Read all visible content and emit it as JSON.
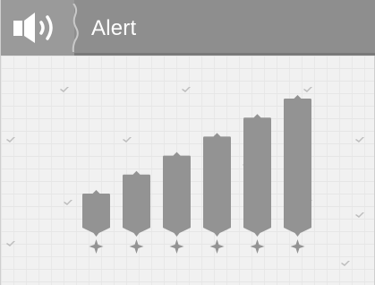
{
  "header": {
    "title": "Alert",
    "icon": "speaker-volume-icon"
  },
  "volume_levels": {
    "count": 6,
    "selected_level": 6
  },
  "colors": {
    "header_bg": "#8e8e8e",
    "bar": "#939393",
    "background": "#f1f1f1",
    "text": "#ffffff"
  }
}
